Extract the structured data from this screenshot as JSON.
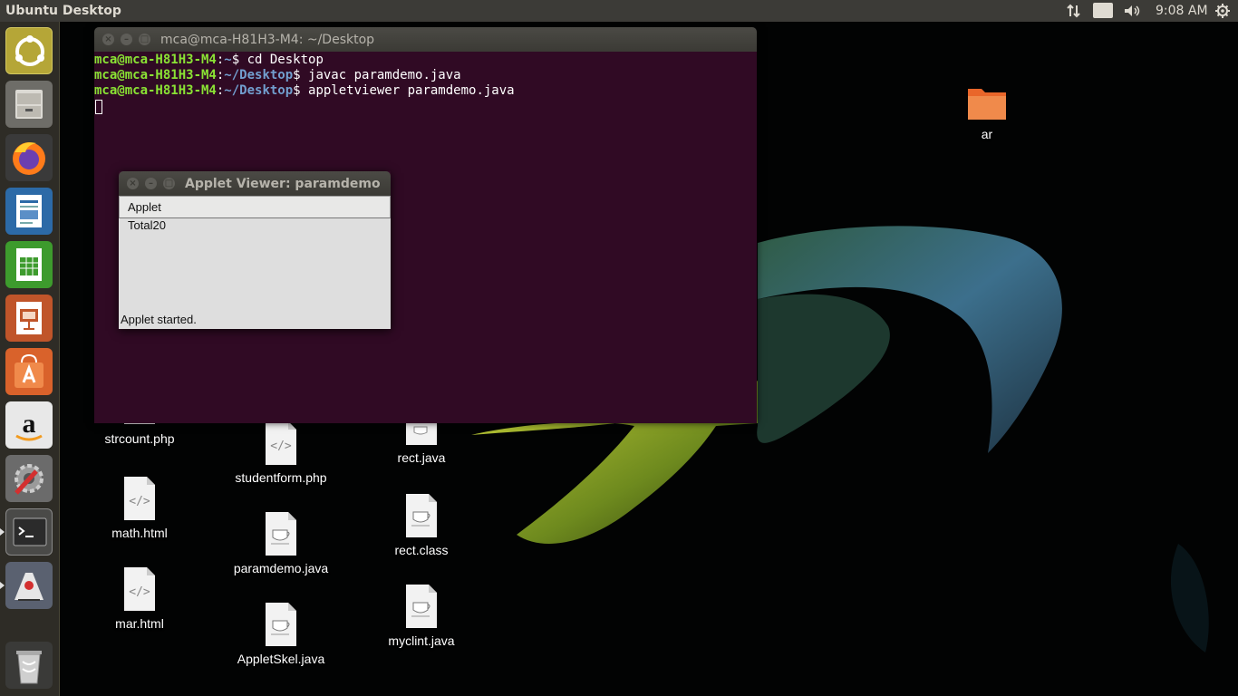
{
  "top_panel": {
    "title": "Ubuntu Desktop",
    "keyboard_layout": "En",
    "clock": "9:08 AM"
  },
  "launcher": {
    "items": [
      {
        "name": "ubuntu-dash-icon"
      },
      {
        "name": "files-icon"
      },
      {
        "name": "firefox-icon"
      },
      {
        "name": "writer-icon"
      },
      {
        "name": "calc-icon"
      },
      {
        "name": "impress-icon"
      },
      {
        "name": "software-center-icon"
      },
      {
        "name": "amazon-icon"
      },
      {
        "name": "system-settings-icon"
      },
      {
        "name": "terminal-icon"
      },
      {
        "name": "java-icon"
      },
      {
        "name": "trash-icon"
      }
    ]
  },
  "terminal": {
    "title": "mca@mca-H81H3-M4: ~/Desktop",
    "lines": [
      {
        "user": "mca@mca-H81H3-M4",
        "path": "~",
        "command": "cd Desktop"
      },
      {
        "user": "mca@mca-H81H3-M4",
        "path": "~/Desktop",
        "command": "javac paramdemo.java"
      },
      {
        "user": "mca@mca-H81H3-M4",
        "path": "~/Desktop",
        "command": "appletviewer paramdemo.java"
      }
    ]
  },
  "applet_viewer": {
    "title": "Applet Viewer: paramdemo",
    "menu": "Applet",
    "output": "Total20",
    "status": "Applet started."
  },
  "desktop_icons": {
    "ar": "ar",
    "strcount": "strcount.php",
    "studentform": "studentform.php",
    "rect_java": "rect.java",
    "math": "math.html",
    "rect_class": "rect.class",
    "paramdemo": "paramdemo.java",
    "mar": "mar.html",
    "myclint": "myclint.java",
    "appletskel": "AppletSkel.java"
  },
  "colors": {
    "panel": "#3c3b37",
    "launcher": "#2e2c26",
    "terminal_bg": "#300a24",
    "prompt_user": "#8ae234",
    "prompt_path": "#729fcf"
  }
}
